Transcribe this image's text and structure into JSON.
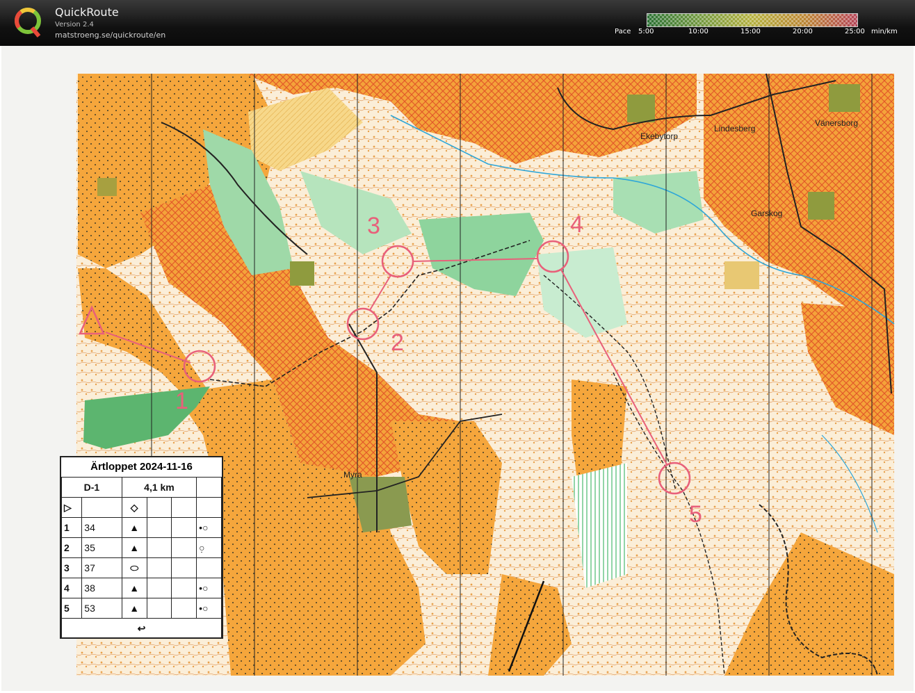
{
  "header": {
    "title": "QuickRoute",
    "version": "Version 2.4",
    "url": "matstroeng.se/quickroute/en",
    "pace_label": "Pace",
    "pace_ticks": [
      "5:00",
      "10:00",
      "15:00",
      "20:00",
      "25:00"
    ],
    "pace_unit": "min/km",
    "pace_colors": [
      "#2e8b3a",
      "#8fc24a",
      "#e8e24a",
      "#f0a83a",
      "#e8506a"
    ]
  },
  "map": {
    "place_names": [
      "Ekebytorp",
      "Lindesberg",
      "Vänersborg",
      "Garskog",
      "Myra"
    ],
    "control_numbers": [
      "1",
      "2",
      "3",
      "4",
      "5"
    ],
    "course_color": "#e8607a"
  },
  "legend": {
    "title": "Ärtloppet 2024-11-16",
    "class": "D-1",
    "length": "4,1 km",
    "start_symbol": "▷",
    "start_desc": "◇",
    "finish_symbol": "↩",
    "rows": [
      {
        "num": "1",
        "code": "34",
        "feature": "▲",
        "where": "•○"
      },
      {
        "num": "2",
        "code": "35",
        "feature": "▲",
        "where": "○̣"
      },
      {
        "num": "3",
        "code": "37",
        "feature": "⬭",
        "where": ""
      },
      {
        "num": "4",
        "code": "38",
        "feature": "▲",
        "where": "•○"
      },
      {
        "num": "5",
        "code": "53",
        "feature": "▲",
        "where": "•○"
      }
    ]
  }
}
